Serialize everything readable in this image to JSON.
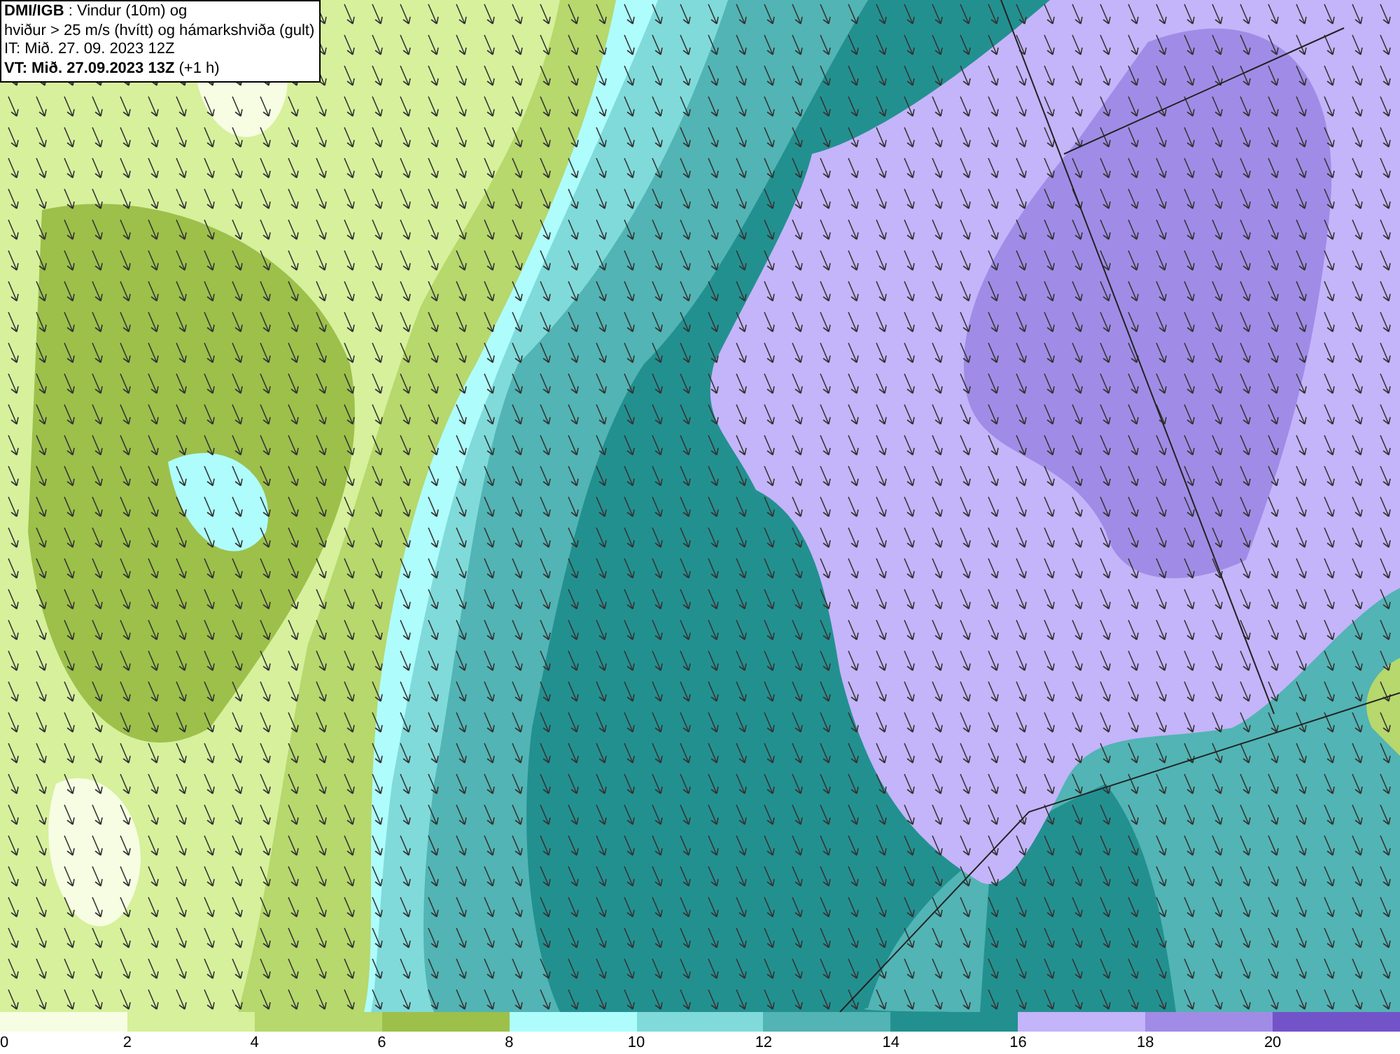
{
  "title_lines": [
    "**DMI/IGB** : Vindur (10m) og",
    "hviður > 25 m/s (hvítt) og hámarkshviða (gult)",
    "IT: Mið. 27. 09. 2023 12Z",
    "**VT: Mið. 27.09.2023 13Z** (+1 h)"
  ],
  "legend": {
    "bins": [
      {
        "color": "#f6fde2"
      },
      {
        "color": "#d6f09c"
      },
      {
        "color": "#b6d86c"
      },
      {
        "color": "#9cc04a"
      },
      {
        "color": "#aefcfc"
      },
      {
        "color": "#80dada"
      },
      {
        "color": "#52b4b4"
      },
      {
        "color": "#239090"
      },
      {
        "color": "#c4b4fa"
      },
      {
        "color": "#a08ce6"
      },
      {
        "color": "#7354c8"
      }
    ],
    "ticks": [
      "0",
      "2",
      "4",
      "6",
      "8",
      "10",
      "12",
      "14",
      "16",
      "18",
      "20"
    ]
  }
}
